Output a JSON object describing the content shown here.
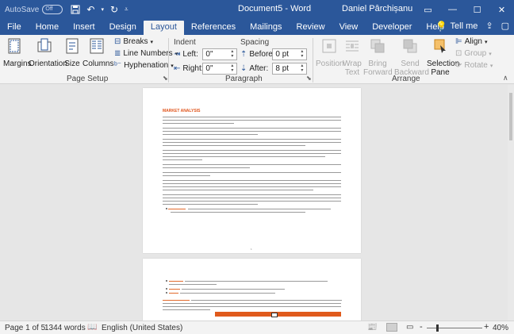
{
  "titlebar": {
    "autosave_label": "AutoSave",
    "autosave_state": "Off",
    "document_name": "Document5",
    "separator": "-",
    "app_name": "Word",
    "user_name": "Daniel Pârchișanu"
  },
  "tabs": [
    "File",
    "Home",
    "Insert",
    "Design",
    "Layout",
    "References",
    "Mailings",
    "Review",
    "View",
    "Developer",
    "Help"
  ],
  "active_tab": "Layout",
  "tell_me": "Tell me",
  "page_setup": {
    "margins": "Margins",
    "orientation": "Orientation",
    "size": "Size",
    "columns": "Columns",
    "breaks": "Breaks",
    "line_numbers": "Line Numbers",
    "hyphenation": "Hyphenation",
    "label": "Page Setup"
  },
  "paragraph": {
    "indent_header": "Indent",
    "spacing_header": "Spacing",
    "left_label": "Left:",
    "left_value": "0\"",
    "right_label": "Right:",
    "right_value": "0\"",
    "before_label": "Before:",
    "before_value": "0 pt",
    "after_label": "After:",
    "after_value": "8 pt",
    "label": "Paragraph"
  },
  "arrange": {
    "position": "Position",
    "wrap_text_1": "Wrap",
    "wrap_text_2": "Text",
    "bring_forward_1": "Bring",
    "bring_forward_2": "Forward",
    "send_backward_1": "Send",
    "send_backward_2": "Backward",
    "selection_pane_1": "Selection",
    "selection_pane_2": "Pane",
    "align": "Align",
    "group": "Group",
    "rotate": "Rotate",
    "label": "Arrange"
  },
  "document": {
    "heading": "MARKET ANALYSIS",
    "page_number": "1"
  },
  "status": {
    "page": "Page 1 of 5",
    "words": "1344 words",
    "language": "English (United States)",
    "zoom_minus": "-",
    "zoom_plus": "+",
    "zoom": "40%"
  },
  "colors": {
    "brand": "#2b579a",
    "heading": "#e0541b"
  }
}
